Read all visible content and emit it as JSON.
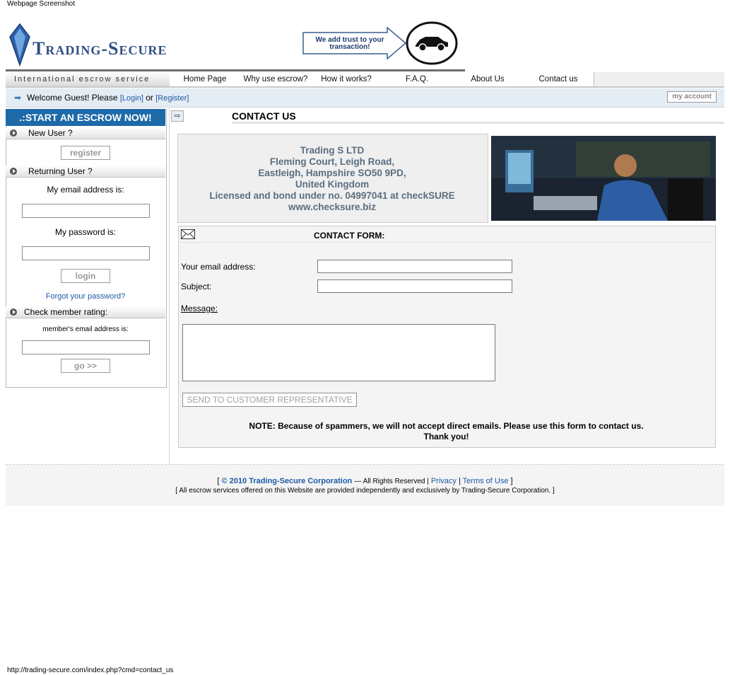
{
  "caption": "Webpage Screenshot",
  "brand": {
    "logo_text": "Trading-Secure",
    "trust_badge": "We add trust to your transaction!"
  },
  "nav": {
    "tagline": "International escrow service",
    "items": [
      "Home Page",
      "Why use escrow?",
      "How it works?",
      "F.A.Q.",
      "About Us",
      "Contact us"
    ]
  },
  "welcome": {
    "text": "Welcome Guest! Please",
    "login": "[Login]",
    "or": "or",
    "register": "[Register]",
    "account_button": "my account"
  },
  "sidebar": {
    "header": ".:START AN ESCROW NOW!",
    "new_user": {
      "title": "New User ?",
      "button": "register"
    },
    "returning": {
      "title": "Returning User ?",
      "email_label": "My email address is:",
      "password_label": "My password is:",
      "login_button": "login",
      "forgot": "Forgot your password?"
    },
    "rating": {
      "title": "Check member rating:",
      "email_label": "member's email address is:",
      "go_button": "go >>"
    }
  },
  "main": {
    "title": "CONTACT US",
    "company": [
      "Trading S LTD",
      "Fleming Court, Leigh Road,",
      "Eastleigh, Hampshire SO50 9PD,",
      "United Kingdom",
      "Licensed and bond under no. 04997041 at checkSURE",
      "www.checksure.biz"
    ],
    "form": {
      "header": "CONTACT FORM:",
      "email_label": "Your email address:",
      "subject_label": "Subject:",
      "message_label": "Message:",
      "send_button": "SEND TO CUSTOMER REPRESENTATIVE",
      "note_line1": "NOTE: Because of spammers, we will not accept direct emails. Please use this form to contact us.",
      "note_line2": "Thank you!"
    }
  },
  "footer": {
    "open": "[",
    "copyright": "© 2010 Trading-Secure Corporation",
    "rights": "— All Rights Reserved |",
    "privacy": "Privacy",
    "sep": "|",
    "terms": "Terms of Use",
    "close": "]",
    "line2": "[ All escrow services offered on this Website are provided independently and exclusively by Trading-Secure Corporation. ]"
  },
  "status_url": "http://trading-secure.com/index.php?cmd=contact_us",
  "colors": {
    "header_blue": "#1d6aa8",
    "link_blue": "#1e5aa6",
    "company_text": "#5a6e7f"
  }
}
